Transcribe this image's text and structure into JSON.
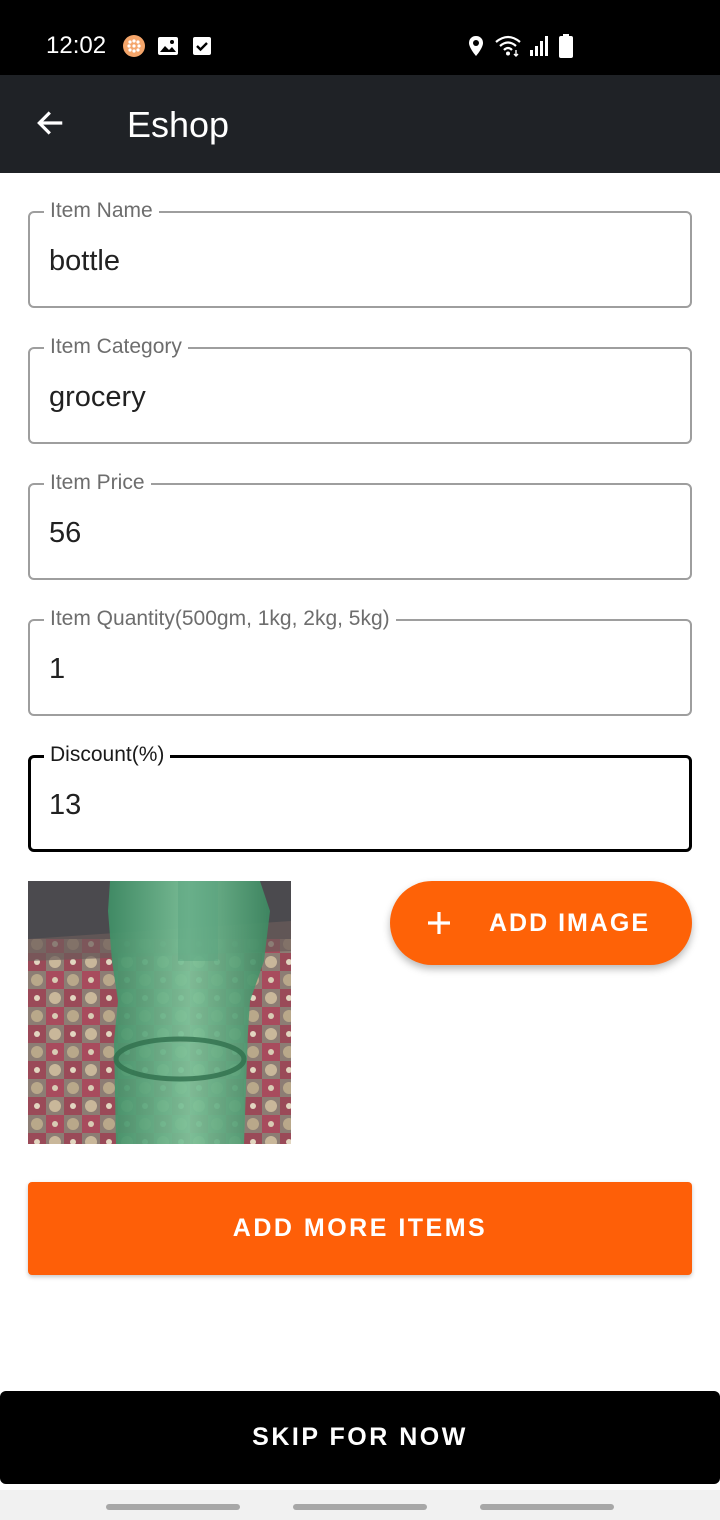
{
  "status_bar": {
    "time": "12:02",
    "left_icons": [
      "app-notification-icon",
      "gallery-icon",
      "checkbox-icon"
    ],
    "right_icons": [
      "location-icon",
      "wifi-icon",
      "signal-icon",
      "battery-icon"
    ]
  },
  "app_bar": {
    "title": "Eshop",
    "back_icon": "arrow-left-icon"
  },
  "form": {
    "item_name": {
      "label": "Item Name",
      "value": "bottle"
    },
    "item_category": {
      "label": "Item Category",
      "value": "grocery"
    },
    "item_price": {
      "label": "Item Price",
      "value": "56"
    },
    "item_quantity": {
      "label": "Item Quantity(500gm, 1kg, 2kg, 5kg)",
      "value": "1"
    },
    "discount": {
      "label": "Discount(%)",
      "value": "13"
    }
  },
  "image_section": {
    "add_image_label": "ADD IMAGE",
    "add_icon": "plus-icon"
  },
  "actions": {
    "add_more_label": "ADD MORE ITEMS",
    "skip_label": "SKIP FOR NOW"
  },
  "colors": {
    "accent": "#fe6207",
    "app_bar": "#1f2226",
    "status_bar": "#000000",
    "skip_button": "#000000"
  }
}
